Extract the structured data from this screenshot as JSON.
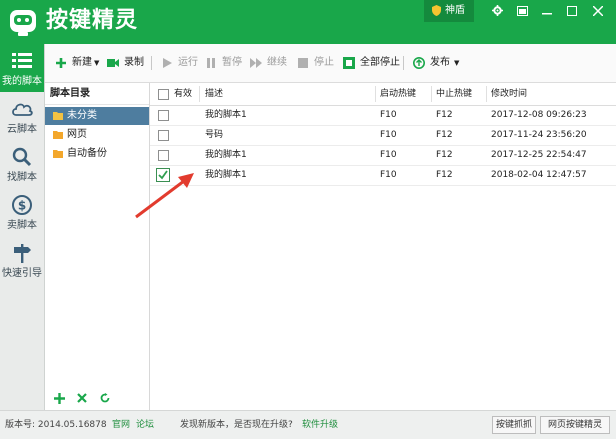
{
  "app": {
    "title": "按键精灵",
    "shield_label": "神盾"
  },
  "nav": [
    {
      "label": "我的脚本",
      "icon": "list-icon",
      "active": true
    },
    {
      "label": "云脚本",
      "icon": "cloud-icon"
    },
    {
      "label": "找脚本",
      "icon": "search-icon"
    },
    {
      "label": "卖脚本",
      "icon": "dollar-icon"
    },
    {
      "label": "快速引导",
      "icon": "signpost-icon"
    }
  ],
  "toolbar": {
    "new": "新建",
    "record": "录制",
    "run": "运行",
    "pause": "暂停",
    "continue": "继续",
    "stop": "停止",
    "stop_all": "全部停止",
    "publish": "发布"
  },
  "tree": {
    "header": "脚本目录",
    "items": [
      {
        "label": "未分类",
        "selected": true
      },
      {
        "label": "网页"
      },
      {
        "label": "自动备份"
      }
    ]
  },
  "table": {
    "columns": [
      "有效",
      "描述",
      "启动热键",
      "中止热键",
      "修改时间"
    ],
    "rows": [
      {
        "checked": false,
        "desc": "我的脚本1",
        "start": "F10",
        "stop": "F12",
        "time": "2017-12-08 09:26:23"
      },
      {
        "checked": false,
        "desc": "号码",
        "start": "F10",
        "stop": "F12",
        "time": "2017-11-24 23:56:20"
      },
      {
        "checked": false,
        "desc": "我的脚本1",
        "start": "F10",
        "stop": "F12",
        "time": "2017-12-25 22:54:47"
      },
      {
        "checked": true,
        "desc": "我的脚本1",
        "start": "F10",
        "stop": "F12",
        "time": "2018-02-04 12:47:57"
      }
    ]
  },
  "status": {
    "version": "版本号: 2014.05.16878",
    "official": "官网",
    "forum": "论坛",
    "update_msg": "发现新版本，是否现在升级?",
    "upgrade": "软件升级",
    "btn_capture": "按键抓抓",
    "btn_web": "网页按键精灵"
  },
  "colors": {
    "brand": "#19a74a",
    "selected_tree": "#4e7d9f",
    "arrow": "#e23b2e"
  }
}
